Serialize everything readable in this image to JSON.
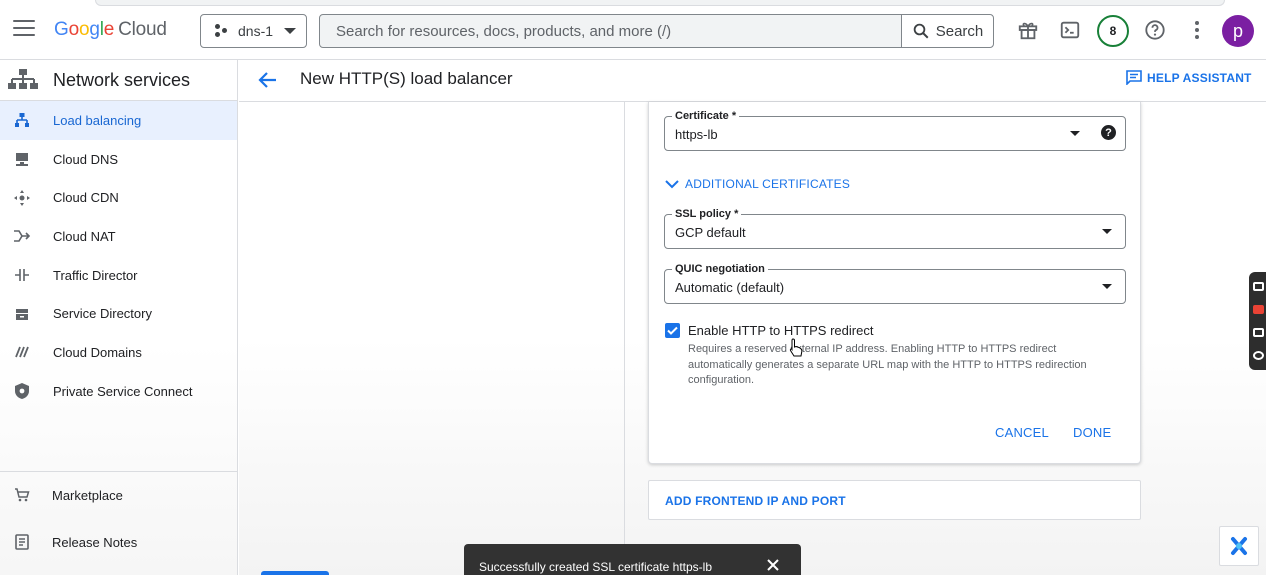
{
  "topbar": {
    "logo": {
      "google": "Google",
      "cloud": "Cloud"
    },
    "project": "dns-1",
    "search": {
      "placeholder": "Search for resources, docs, products, and more (/)",
      "button": "Search"
    },
    "notifications_count": "8",
    "avatar_initial": "p"
  },
  "sidebar": {
    "title": "Network services",
    "items": [
      {
        "label": "Load balancing",
        "icon": "load-balancing-icon",
        "active": true
      },
      {
        "label": "Cloud DNS",
        "icon": "dns-icon"
      },
      {
        "label": "Cloud CDN",
        "icon": "cdn-icon"
      },
      {
        "label": "Cloud NAT",
        "icon": "nat-icon"
      },
      {
        "label": "Traffic Director",
        "icon": "traffic-director-icon"
      },
      {
        "label": "Service Directory",
        "icon": "service-directory-icon"
      },
      {
        "label": "Cloud Domains",
        "icon": "domains-icon"
      },
      {
        "label": "Private Service Connect",
        "icon": "shield-icon"
      }
    ],
    "bottom": [
      {
        "label": "Marketplace",
        "icon": "cart-icon"
      },
      {
        "label": "Release Notes",
        "icon": "notes-icon"
      }
    ]
  },
  "header": {
    "title": "New HTTP(S) load balancer",
    "help_assistant": "HELP ASSISTANT"
  },
  "form": {
    "certificate": {
      "label": "Certificate *",
      "value": "https-lb"
    },
    "additional_certificates": "ADDITIONAL CERTIFICATES",
    "ssl_policy": {
      "label": "SSL policy *",
      "value": "GCP default"
    },
    "quic": {
      "label": "QUIC negotiation",
      "value": "Automatic (default)"
    },
    "redirect": {
      "label": "Enable HTTP to HTTPS redirect",
      "checked": true,
      "description": "Requires a reserved external IP address. Enabling HTTP to HTTPS redirect automatically generates a separate URL map with the HTTP to HTTPS redirection configuration."
    },
    "cancel": "CANCEL",
    "done": "DONE",
    "add_frontend": "ADD FRONTEND IP AND PORT"
  },
  "toast": {
    "message": "Successfully created SSL certificate https-lb"
  },
  "colors": {
    "accent": "#1a73e8",
    "active_bg": "#e8f0fe",
    "avatar": "#7b1fa2",
    "badge_ring": "#188038",
    "toast_bg": "#323232"
  }
}
